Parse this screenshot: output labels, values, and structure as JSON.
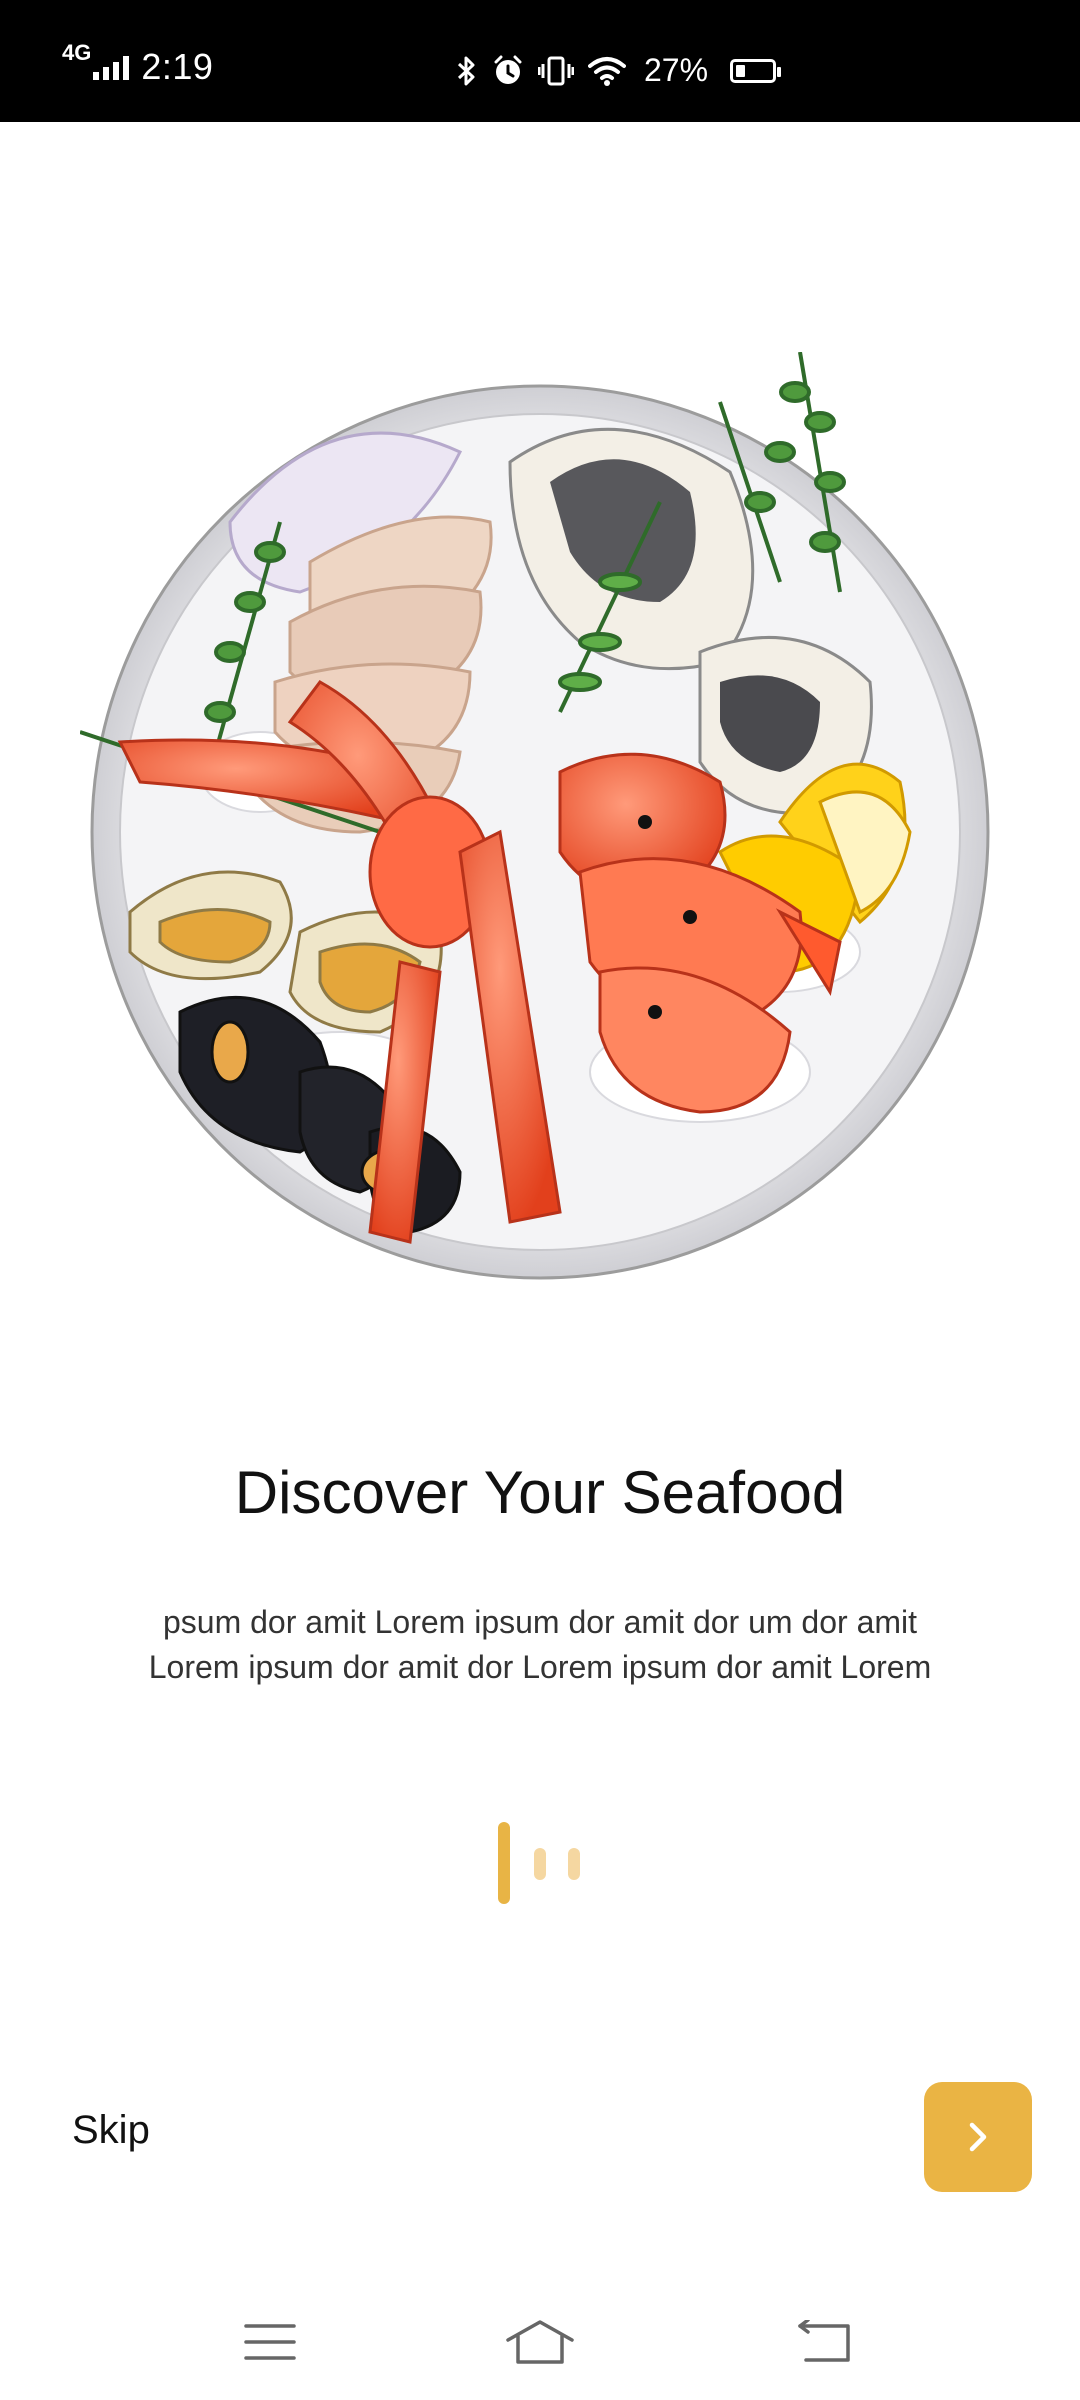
{
  "status_bar": {
    "network": "4G",
    "time": "2:19",
    "battery_percent": "27%",
    "icons": [
      "signal-icon",
      "bluetooth-icon",
      "alarm-icon",
      "vibrate-icon",
      "wifi-icon",
      "battery-icon"
    ]
  },
  "onboarding": {
    "image": "seafood-platter-illustration",
    "title": "Discover Your Seafood",
    "description_line1": "psum dor amit Lorem ipsum dor amit dor um dor amit",
    "description_line2": "Lorem ipsum dor amit dor Lorem ipsum dor amit Lorem",
    "page_index": 1,
    "page_count": 3,
    "skip_label": "Skip",
    "next_icon": "chevron-right-icon"
  },
  "colors": {
    "accent": "#EAB444",
    "accent_light": "#F5D7A1",
    "text": "#111111",
    "status_bar": "#000000"
  },
  "nav_bar": {
    "icons": [
      "menu-icon",
      "home-icon",
      "back-icon"
    ]
  }
}
